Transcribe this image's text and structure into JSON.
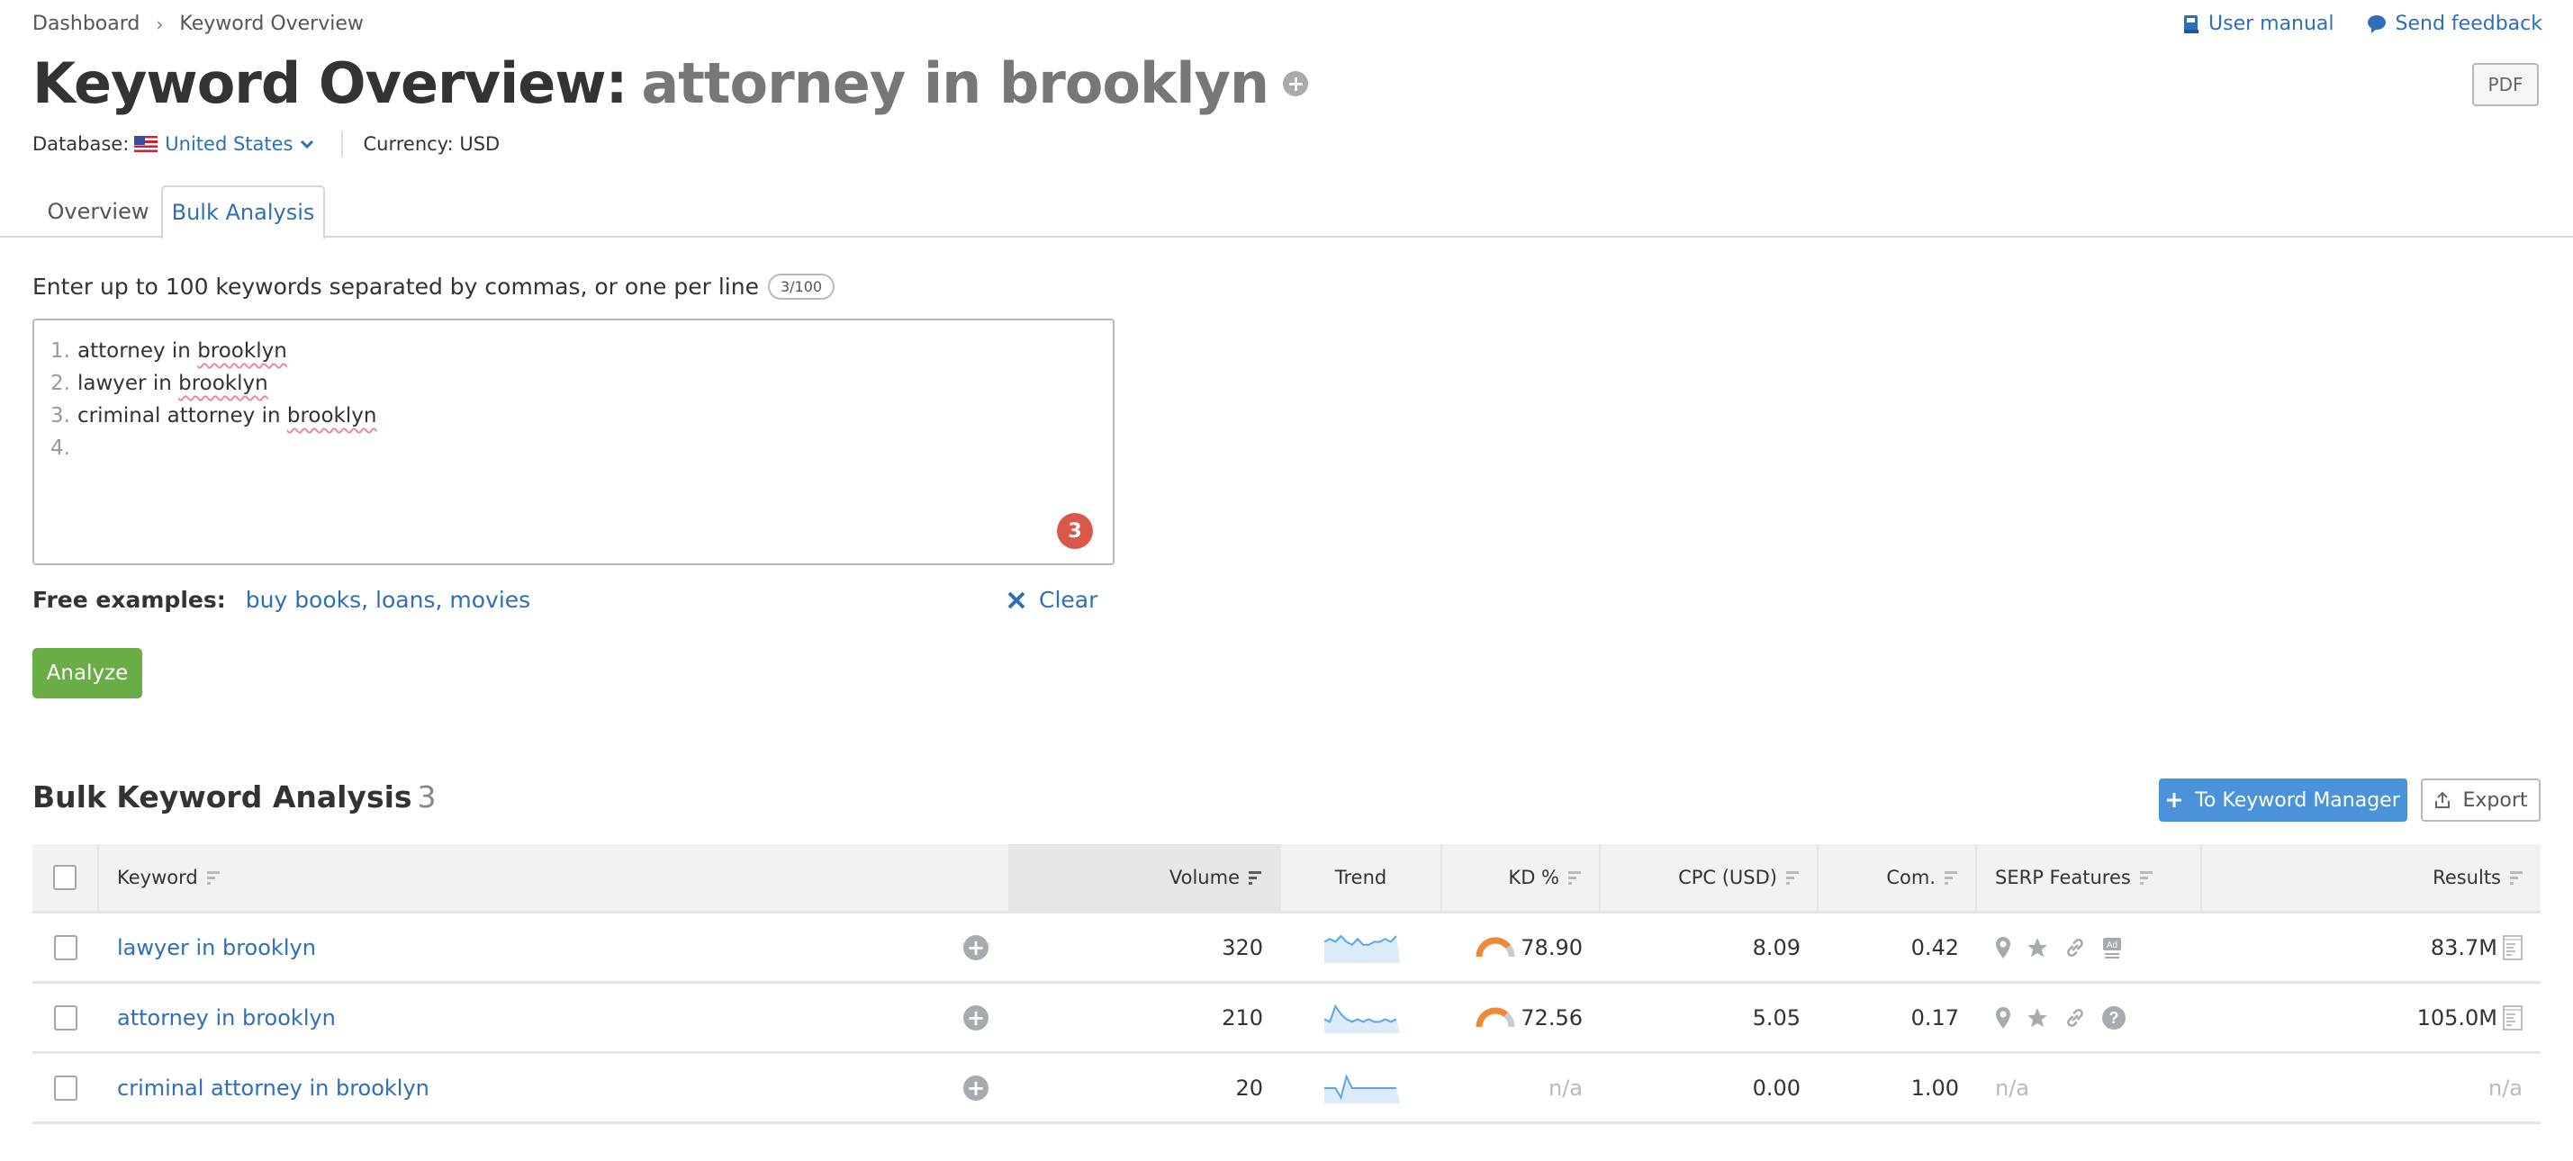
{
  "breadcrumb": [
    "Dashboard",
    "Keyword Overview"
  ],
  "top_links": {
    "user_manual": "User manual",
    "send_feedback": "Send feedback"
  },
  "pdf_label": "PDF",
  "title": {
    "prefix": "Keyword Overview:",
    "keyword": "attorney in brooklyn"
  },
  "meta": {
    "database_label": "Database:",
    "database_value": "United States",
    "currency": "Currency: USD"
  },
  "tabs": [
    {
      "label": "Overview",
      "active": false
    },
    {
      "label": "Bulk Analysis",
      "active": true
    }
  ],
  "input": {
    "instruction": "Enter up to 100 keywords separated by commas, or one per line",
    "counter": "3/100",
    "lines": [
      {
        "num": "1.",
        "pre": "attorney in ",
        "misspelled": "brooklyn"
      },
      {
        "num": "2.",
        "pre": "lawyer in ",
        "misspelled": "brooklyn"
      },
      {
        "num": "3.",
        "pre": "criminal attorney in ",
        "misspelled": "brooklyn"
      },
      {
        "num": "4.",
        "pre": "",
        "misspelled": ""
      }
    ],
    "error_count": "3",
    "free_examples_label": "Free examples:",
    "free_examples": "buy books, loans, movies",
    "clear_label": "Clear",
    "analyze_label": "Analyze"
  },
  "results": {
    "title": "Bulk Keyword Analysis",
    "count": "3",
    "to_keyword_manager": "To Keyword Manager",
    "export": "Export",
    "columns": [
      "Keyword",
      "Volume",
      "Trend",
      "KD %",
      "CPC (USD)",
      "Com.",
      "SERP Features",
      "Results"
    ],
    "sorted_column": "Volume",
    "rows": [
      {
        "keyword": "lawyer in brooklyn",
        "volume": "320",
        "trend": [
          6,
          7,
          6,
          8,
          6,
          5,
          7,
          5,
          5,
          6,
          6,
          7,
          6,
          8
        ],
        "kd": "78.90",
        "kd_pct": 78.9,
        "cpc": "8.09",
        "com": "0.42",
        "serp": [
          "local-pack",
          "reviews",
          "sitelinks",
          "ads"
        ],
        "results": "83.7M"
      },
      {
        "keyword": "attorney in brooklyn",
        "volume": "210",
        "trend": [
          4,
          3,
          9,
          6,
          4,
          3,
          4,
          3,
          4,
          3,
          3,
          4,
          3,
          4
        ],
        "kd": "72.56",
        "kd_pct": 72.56,
        "cpc": "5.05",
        "com": "0.17",
        "serp": [
          "local-pack",
          "reviews",
          "sitelinks",
          "people-also-ask"
        ],
        "results": "105.0M"
      },
      {
        "keyword": "criminal attorney in brooklyn",
        "volume": "20",
        "trend": [
          5,
          5,
          5,
          1,
          10,
          5,
          5,
          5,
          5,
          5,
          5,
          5,
          5,
          5
        ],
        "kd": "n/a",
        "kd_pct": null,
        "cpc": "0.00",
        "com": "1.00",
        "serp": [],
        "serp_text": "n/a",
        "results": "n/a"
      }
    ]
  },
  "colors": {
    "link": "#2f6eb8",
    "analyze": "#6aac45",
    "primary_button": "#4a93d9",
    "error_badge": "#d9584a",
    "kd_hard": "#f0883a",
    "trend_line": "#5aa6e6",
    "trend_fill": "#dcebfa"
  }
}
